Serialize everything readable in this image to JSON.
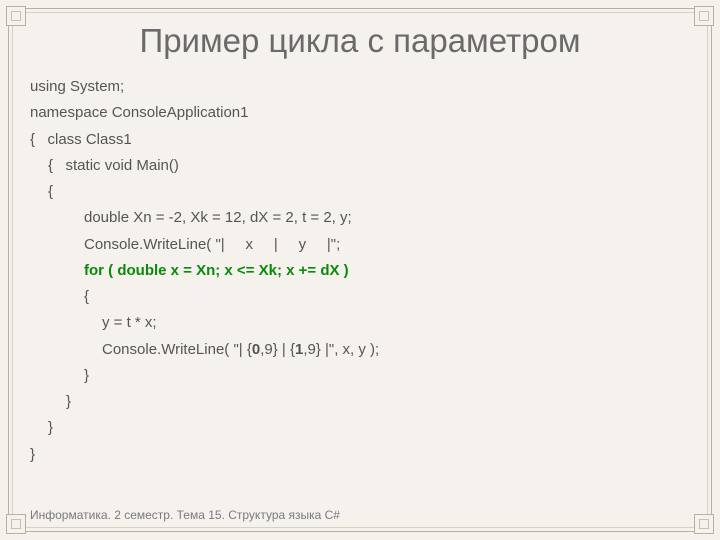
{
  "title": "Пример цикла с параметром",
  "code": {
    "l1": "using System;",
    "l2": "namespace ConsoleApplication1",
    "l3": "{   class Class1",
    "l4": "{   static void Main()",
    "l5": "{",
    "l6": "double Xn = -2, Xk = 12, dX = 2, t = 2, y;",
    "l7": "Console.WriteLine( \"|     x     |     y     |\";",
    "l8": "for ( double x = Xn; x <= Xk; x += dX )",
    "l9": "{",
    "l10a": "y = t * x;",
    "l10b_pre": "Console.WriteLine( \"| {",
    "l10b_b1": "0",
    "l10b_mid1": ",9} | {",
    "l10b_b2": "1",
    "l10b_mid2": ",9} |\", x, y );",
    "l11": "}",
    "l12": "}",
    "l13": "}",
    "l14": "}"
  },
  "footer": "Информатика. 2 семестр. Тема 15. Структура языка С#"
}
